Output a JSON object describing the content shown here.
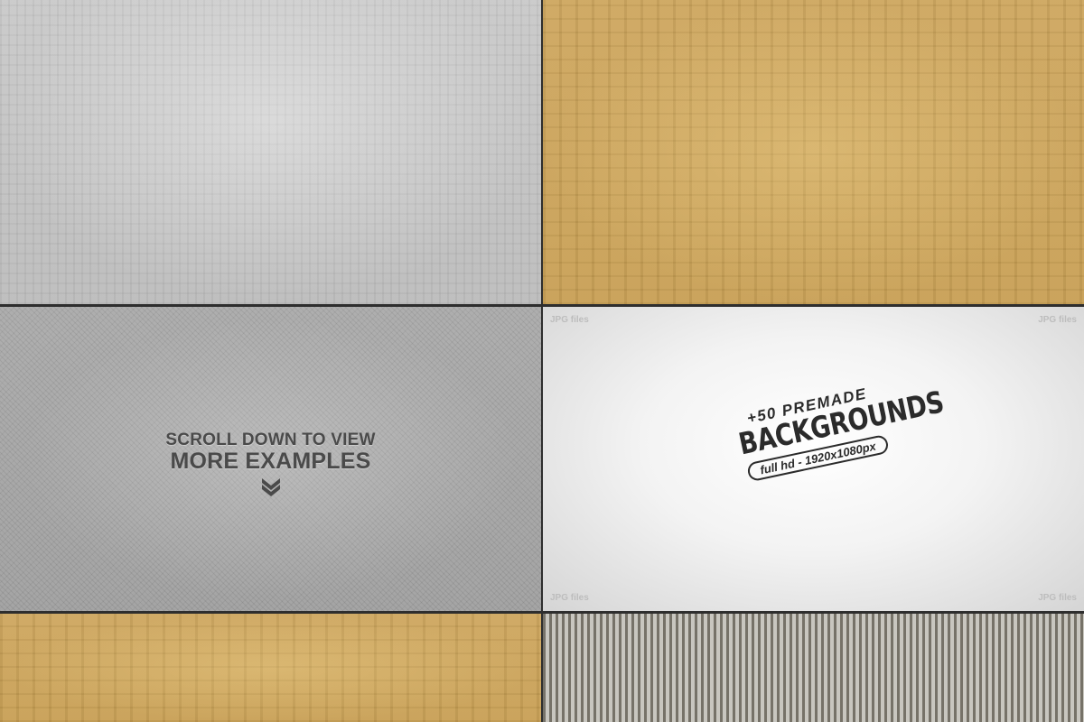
{
  "scroll": {
    "line1": "SCROLL DOWN TO VIEW",
    "line2": "MORE EXAMPLES",
    "icon": "double-chevron-down-icon"
  },
  "preview": {
    "corner_label": "JPG files",
    "badge_top": "+50 PREMADE",
    "badge_main": "BACKGROUNDS",
    "badge_sub": "full hd - 1920x1080px"
  },
  "colors": {
    "silver": "#c4c4c4",
    "gold": "#cba258",
    "gray": "#a6a6a6",
    "paper": "#f2f2f2",
    "divider": "#2e2e2e",
    "text": "#4a4a4a"
  }
}
